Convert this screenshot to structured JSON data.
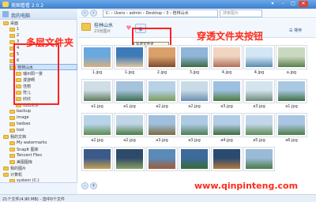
{
  "window": {
    "title": "美图看看 2.0.2",
    "buttons": [
      "▾",
      "–",
      "□",
      "✕"
    ]
  },
  "sidebar": {
    "header": "我的电脑",
    "items": [
      {
        "label": "桌面",
        "indent": 1
      },
      {
        "label": "1",
        "indent": 2
      },
      {
        "label": "2",
        "indent": 2
      },
      {
        "label": "3",
        "indent": 2
      },
      {
        "label": "4",
        "indent": 2
      },
      {
        "label": "5",
        "indent": 2
      },
      {
        "label": "6",
        "indent": 2
      },
      {
        "label": "桂林山水",
        "indent": 2,
        "selected": true
      },
      {
        "label": "瑞州阳一景",
        "indent": 3
      },
      {
        "label": "漫游啊",
        "indent": 3
      },
      {
        "label": "佳丽",
        "indent": 3
      },
      {
        "label": "符儿",
        "indent": 3
      },
      {
        "label": "欣欣",
        "indent": 3
      },
      {
        "label": "山山水水",
        "indent": 3
      },
      {
        "label": "backup",
        "indent": 2
      },
      {
        "label": "image",
        "indent": 2
      },
      {
        "label": "taobao",
        "indent": 2
      },
      {
        "label": "tool",
        "indent": 2
      },
      {
        "label": "我的文档",
        "indent": 1
      },
      {
        "label": "My watermarks",
        "indent": 2
      },
      {
        "label": "SnapIt 图库",
        "indent": 2
      },
      {
        "label": "Tencent Files",
        "indent": 2
      },
      {
        "label": "美图图库",
        "indent": 2
      },
      {
        "label": "我的图片",
        "indent": 1
      },
      {
        "label": "计算机",
        "indent": 1
      },
      {
        "label": "system (C:)",
        "indent": 2
      }
    ]
  },
  "toolbar": {
    "path": [
      "C:",
      "Users",
      "admin",
      "Desktop",
      "3",
      "桂林山水"
    ],
    "search_placeholder": "搜索图片"
  },
  "infobar": {
    "folder_name": "桂林山水",
    "folder_count": "23张图片",
    "tooltip": "穿透文件夹",
    "sort_label": "排序",
    "heart_icon_color": "#ff7fa0",
    "pierce_icon_color": "#2c6fc7"
  },
  "annotations": {
    "multi_level_folder": "多层文件夹",
    "pierce_button": "穿透文件夹按钮",
    "color": "#ff2020"
  },
  "thumbnails": [
    {
      "label": "1.jpg",
      "c1": "#6aa8e0",
      "c2": "#d9b07f"
    },
    {
      "label": "1.jpg",
      "c1": "#3d7ab8",
      "c2": "#e2c6a0"
    },
    {
      "label": "2.jpg",
      "c1": "#d9a06c",
      "c2": "#7f4a2c"
    },
    {
      "label": "3.jpg",
      "c1": "#8fb5d9",
      "c2": "#3c6a45"
    },
    {
      "label": "4.jpg",
      "c1": "#f0d5c0",
      "c2": "#b07058"
    },
    {
      "label": "4.jpg",
      "c1": "#d2e6f5",
      "c2": "#5a8caf"
    },
    {
      "label": "a.jpg",
      "c1": "#c9d9c0",
      "c2": "#5a7f4a"
    },
    {
      "label": "a1.jpg",
      "c1": "#d0dde6",
      "c2": "#5f7b5a"
    },
    {
      "label": "a1.jpg",
      "c1": "#a6c3dc",
      "c2": "#3d6e52"
    },
    {
      "label": "a2.jpg",
      "c1": "#b7d1e6",
      "c2": "#7a9a5a"
    },
    {
      "label": "a2.jpg",
      "c1": "#cadbe8",
      "c2": "#6a8fae"
    },
    {
      "label": "a3.jpg",
      "c1": "#9ec0e0",
      "c2": "#4a7a3c"
    },
    {
      "label": "a3.jpg",
      "c1": "#d4e4ee",
      "c2": "#6c8a7a"
    },
    {
      "label": "a1.jpg",
      "c1": "#a9c8e2",
      "c2": "#3f6f45"
    },
    {
      "label": "a2.jpg",
      "c1": "#b8d3ea",
      "c2": "#5c8c4a"
    },
    {
      "label": "a2.jpg",
      "c1": "#c0d5e6",
      "c2": "#4d7a42"
    },
    {
      "label": "a3.jpg",
      "c1": "#9fbfdc",
      "c2": "#7a6a3c"
    },
    {
      "label": "a3.jpg",
      "c1": "#aec9e2",
      "c2": "#4c7f58"
    },
    {
      "label": "a4.jpg",
      "c1": "#b2cde6",
      "c2": "#3f6a3c"
    },
    {
      "label": "a5.jpg",
      "c1": "#c2d6ea",
      "c2": "#5f8a50"
    },
    {
      "label": "a6.jpg",
      "c1": "#a8c6e3",
      "c2": "#4e7c46"
    },
    {
      "label": "",
      "c1": "#3a5a8a",
      "c2": "#c9a050"
    },
    {
      "label": "",
      "c1": "#2e4a6a",
      "c2": "#8aa060"
    },
    {
      "label": "",
      "c1": "#5a8ab8",
      "c2": "#a05a38"
    },
    {
      "label": "",
      "c1": "#3c6a9a",
      "c2": "#3a6a3a"
    },
    {
      "label": "",
      "c1": "#2a4a70",
      "c2": "#b07a40"
    },
    {
      "label": "",
      "c1": "#9abbd6",
      "c2": "#4a7a4a"
    }
  ],
  "status": {
    "text": "21个文件(4.90 MB) - 选中0个文件"
  },
  "watermark": "www.qinpinteng.com"
}
